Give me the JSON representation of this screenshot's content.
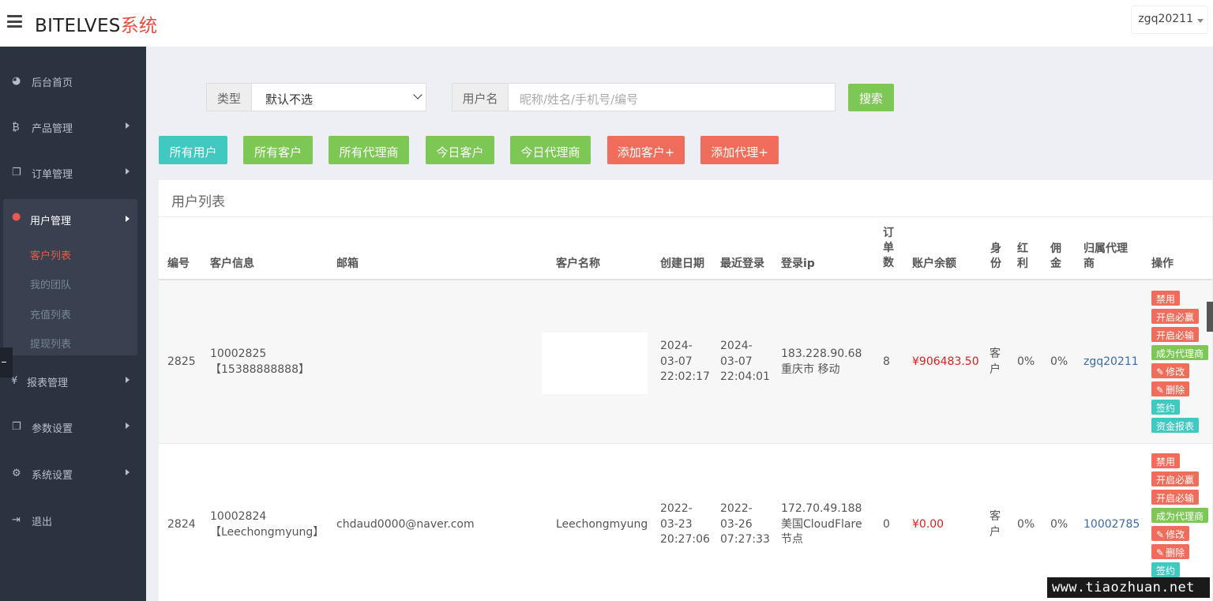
{
  "header": {
    "brand_main": "BITELVES",
    "brand_suffix": "系统",
    "user": "zgq20211"
  },
  "sidebar": {
    "items": [
      {
        "label": "后台首页",
        "icon": "dashboard-icon"
      },
      {
        "label": "产品管理",
        "icon": "bitcoin-icon"
      },
      {
        "label": "订单管理",
        "icon": "copy-icon"
      },
      {
        "label": "用户管理",
        "icon": "user-icon"
      },
      {
        "label": "报表管理",
        "icon": "yen-icon"
      },
      {
        "label": "参数设置",
        "icon": "copy-icon"
      },
      {
        "label": "系统设置",
        "icon": "gears-icon"
      },
      {
        "label": "退出",
        "icon": "sign-out-icon"
      }
    ],
    "submenu": [
      "客户列表",
      "我的团队",
      "充值列表",
      "提现列表"
    ]
  },
  "search": {
    "type_label": "类型",
    "type_value": "默认不选",
    "user_label": "用户名",
    "user_placeholder": "昵称/姓名/手机号/编号",
    "search_button": "搜索"
  },
  "filters": [
    "所有用户",
    "所有客户",
    "所有代理商",
    "今日客户",
    "今日代理商",
    "添加客户+",
    "添加代理+"
  ],
  "panel": {
    "title": "用户列表",
    "columns": [
      "编号",
      "客户信息",
      "邮箱",
      "客户名称",
      "创建日期",
      "最近登录",
      "登录ip",
      "订\n单\n数",
      "账户余额",
      "身\n份",
      "红\n利",
      "佣\n金",
      "归属代理\n商",
      "操作"
    ]
  },
  "rows": [
    {
      "id": "2825",
      "info": "10002825\n【15388888888】",
      "email": "",
      "name": "",
      "created": "2024-\n03-07\n22:02:17",
      "last_login": "2024-\n03-07\n22:04:01",
      "ip": "183.228.90.68\n重庆市 移动",
      "orders": "8",
      "balance": "¥906483.50",
      "role": "客\n户",
      "bonus": "0%",
      "commission": "0%",
      "agent": "zgq20211"
    },
    {
      "id": "2824",
      "info": "10002824\n【Leechongmyung】",
      "email": "chdaud0000@naver.com",
      "name": "Leechongmyung",
      "created": "2022-\n03-23\n20:27:06",
      "last_login": "2022-\n03-26\n07:27:33",
      "ip": "172.70.49.188\n美国CloudFlare\n节点",
      "orders": "0",
      "balance": "¥0.00",
      "role": "客\n户",
      "bonus": "0%",
      "commission": "0%",
      "agent": "10002785"
    }
  ],
  "actions": {
    "disable": "禁用",
    "force_win": "开启必赢",
    "force_lose": "开启必输",
    "make_agent": "成为代理商",
    "edit": "修改",
    "delete": "删除",
    "sign": "签约",
    "funds_report": "资金报表"
  },
  "watermark": "www.tiaozhuan.net"
}
